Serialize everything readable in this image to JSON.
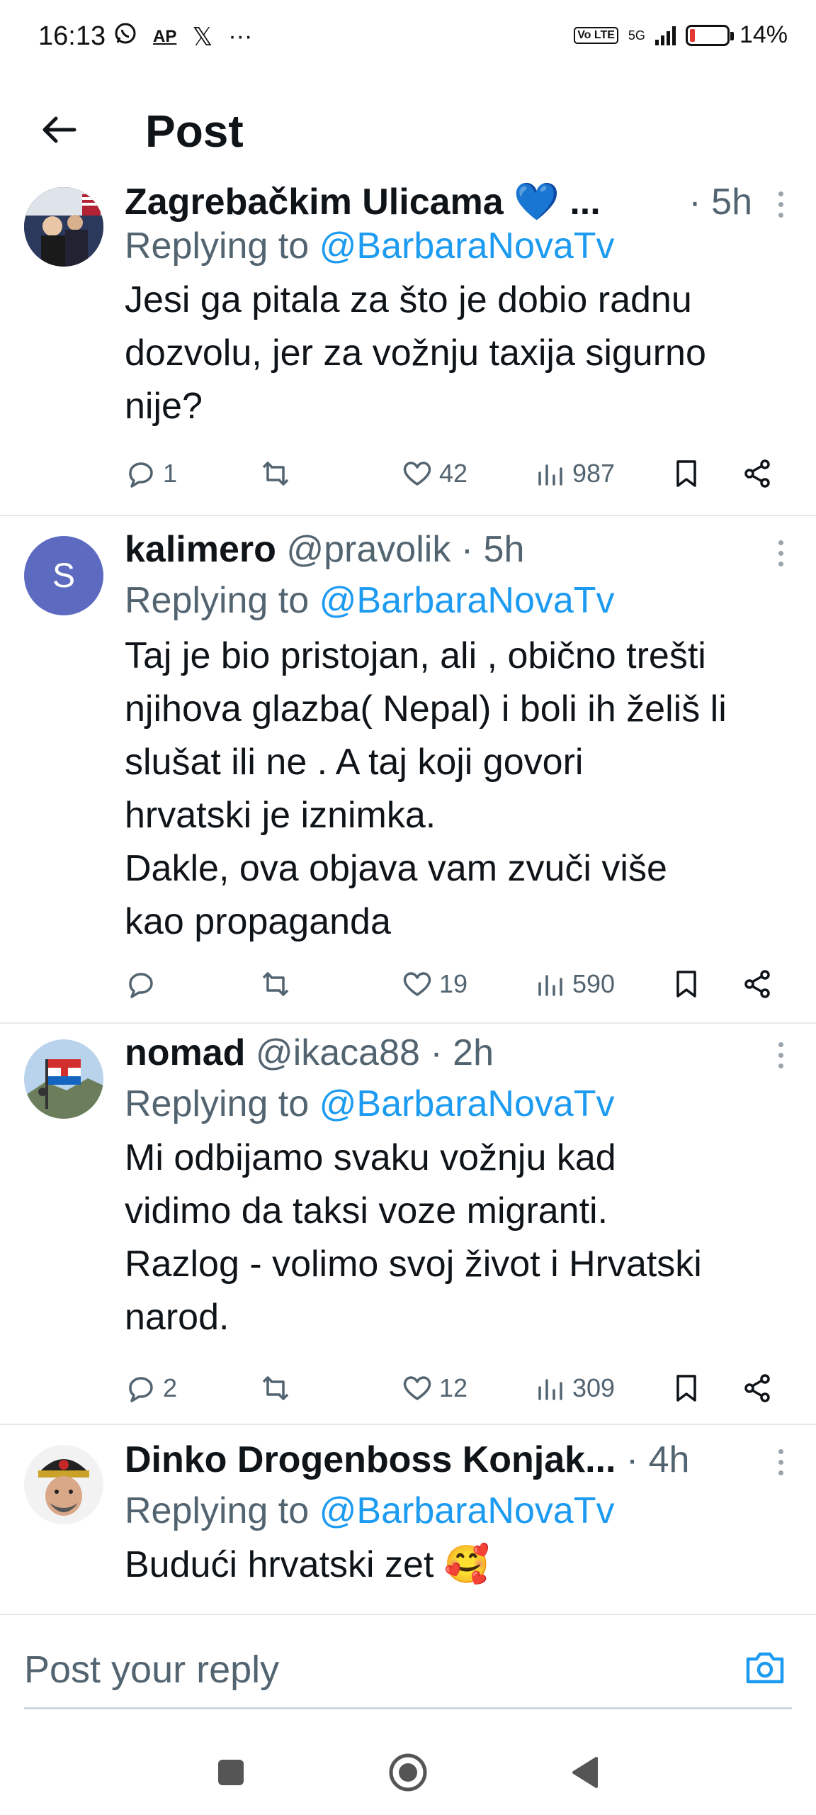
{
  "status_bar": {
    "time": "16:13",
    "left_icons": [
      "whatsapp-icon",
      "ap-icon",
      "x-icon",
      "more-icon"
    ],
    "ap_label": "AP",
    "x_label": "𝕏",
    "more_label": "···",
    "volte": "Vo LTE",
    "network": "5G",
    "battery_level": 0.14,
    "battery_percent": "14%",
    "battery_color": "#e53935"
  },
  "header": {
    "title": "Post"
  },
  "posts": [
    {
      "name": "Zagrebačkim Ulicama 💙 ...",
      "handle": "",
      "time": "· 5h",
      "replying_prefix": "Replying to ",
      "replying_to": "@BarbaraNovaTv",
      "text": "Jesi ga pitala za što je dobio radnu\ndozvolu, jer za vožnju taxija sigurno\nnije?",
      "replies": "1",
      "reposts": "",
      "likes": "42",
      "views": "987"
    },
    {
      "name": "kalimero",
      "handle": "@pravolik",
      "time": "· 5h",
      "avatar_letter": "S",
      "avatar_color": "#5c6bc0",
      "replying_prefix": "Replying to ",
      "replying_to": "@BarbaraNovaTv",
      "text": "Taj je bio pristojan, ali , obično trešti\nnjihova glazba( Nepal) i boli ih želiš li\nslušat ili ne . A taj koji govori\nhrvatski je iznimka.\nDakle, ova objava vam zvuči više\nkao propaganda",
      "replies": "",
      "reposts": "",
      "likes": "19",
      "views": "590"
    },
    {
      "name": "nomad",
      "handle": "@ikaca88",
      "time": "· 2h",
      "replying_prefix": "Replying to ",
      "replying_to": "@BarbaraNovaTv",
      "text": "Mi odbijamo svaku vožnju kad\nvidimo da taksi voze migranti.\nRazlog - volimo svoj život i Hrvatski\nnarod.",
      "replies": "2",
      "reposts": "",
      "likes": "12",
      "views": "309"
    },
    {
      "name": "Dinko Drogenboss Konjak...",
      "handle": "",
      "time": "· 4h",
      "replying_prefix": "Replying to ",
      "replying_to": "@BarbaraNovaTv",
      "text": "Budući hrvatski zet 🥰"
    }
  ],
  "reply_bar": {
    "placeholder": "Post your reply"
  },
  "nav_bar": {
    "buttons": [
      "recents-button",
      "home-button",
      "back-button"
    ]
  },
  "colors": {
    "link": "#1d9bf0",
    "secondary_text": "#536471",
    "divider": "#e6e9eb"
  }
}
